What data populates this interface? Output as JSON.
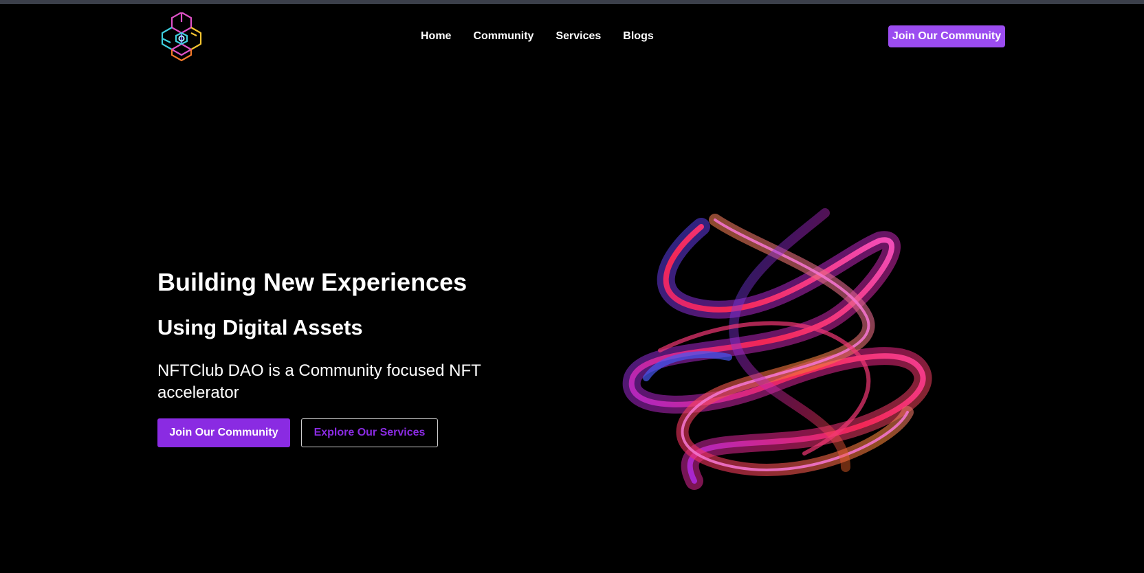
{
  "nav": {
    "logo_icon": "cube-logo-icon",
    "links": [
      "Home",
      "Community",
      "Services",
      "Blogs"
    ],
    "cta_label": "Join Our Community"
  },
  "hero": {
    "title": "Building New Experiences",
    "subtitle": "Using Digital Assets",
    "description": "NFTClub DAO is a Community focused NFT accelerator",
    "primary_button": "Join Our Community",
    "secondary_button": "Explore Our Services",
    "art_icon": "twisted-glass-ribbon-art"
  },
  "colors": {
    "background": "#000000",
    "accent": "#8a2be2",
    "nav_cta": "#9b4cf0"
  }
}
